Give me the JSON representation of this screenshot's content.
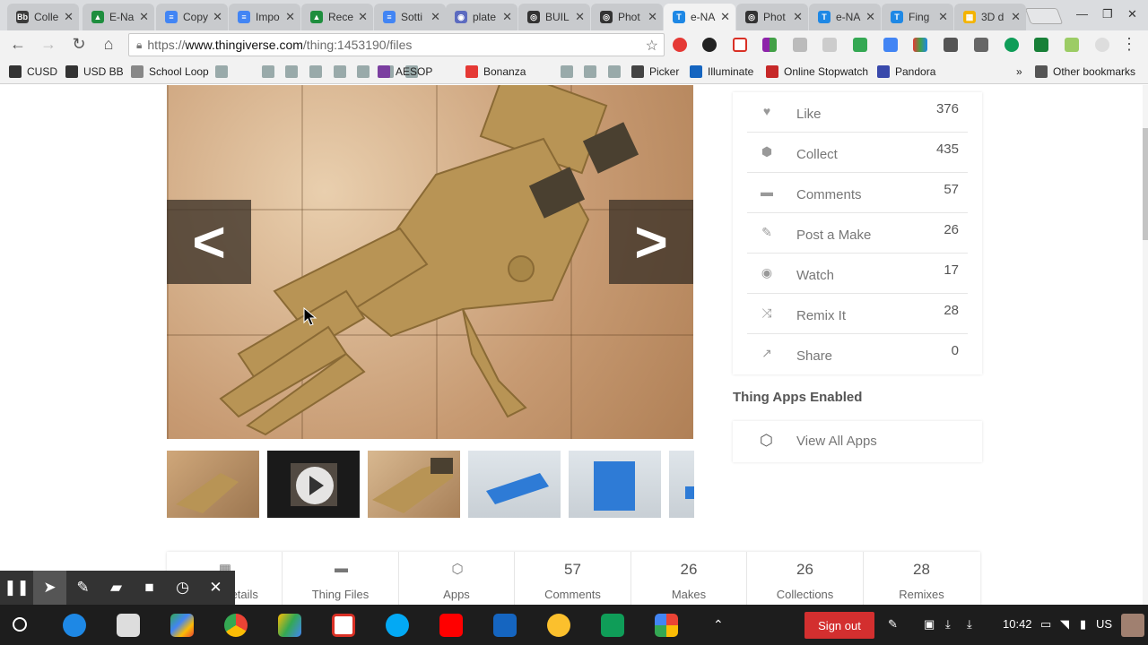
{
  "tabs": [
    {
      "label": "Colle",
      "color": "#3b3b3b",
      "glyph": "Bb"
    },
    {
      "label": "E-Na",
      "color": "#1e8e3e",
      "glyph": "▲"
    },
    {
      "label": "Copy",
      "color": "#4285f4",
      "glyph": "≡"
    },
    {
      "label": "Impo",
      "color": "#4285f4",
      "glyph": "≡"
    },
    {
      "label": "Rece",
      "color": "#1e8e3e",
      "glyph": "▲"
    },
    {
      "label": "Sotti",
      "color": "#4285f4",
      "glyph": "≡"
    },
    {
      "label": "plate",
      "color": "#5c6bc0",
      "glyph": "◉"
    },
    {
      "label": "BUIL",
      "color": "#333333",
      "glyph": "◎"
    },
    {
      "label": "Phot",
      "color": "#333333",
      "glyph": "◎"
    },
    {
      "label": "e-NA",
      "color": "#1e88e5",
      "glyph": "T"
    },
    {
      "label": "Phot",
      "color": "#333333",
      "glyph": "◎"
    },
    {
      "label": "e-NA",
      "color": "#1e88e5",
      "glyph": "T"
    },
    {
      "label": "Fing",
      "color": "#1e88e5",
      "glyph": "T"
    },
    {
      "label": "3D d",
      "color": "#f4b400",
      "glyph": "▦"
    }
  ],
  "address": {
    "prefix": "https://",
    "host": "www.thingiverse.com",
    "path": "/thing:1453190/files"
  },
  "bookmarks": [
    {
      "label": "CUSD",
      "color": "#333"
    },
    {
      "label": "USD BB",
      "color": "#333"
    },
    {
      "label": "School Loop",
      "color": "#888"
    },
    {
      "label": "AESOP",
      "color": "#7b3fa0"
    },
    {
      "label": "Bonanza",
      "color": "#e53935"
    },
    {
      "label": "Picker",
      "color": "#444"
    },
    {
      "label": "Illuminate",
      "color": "#1565c0"
    },
    {
      "label": "Online Stopwatch",
      "color": "#c62828"
    },
    {
      "label": "Pandora",
      "color": "#3949ab"
    },
    {
      "label": "»",
      "color": "transparent"
    },
    {
      "label": "Other bookmarks",
      "color": "#555"
    }
  ],
  "actions": [
    {
      "label": "Like",
      "count": "376",
      "icon": "heart-icon",
      "glyph": "♥"
    },
    {
      "label": "Collect",
      "count": "435",
      "icon": "collect-icon",
      "glyph": "⬢"
    },
    {
      "label": "Comments",
      "count": "57",
      "icon": "comment-icon",
      "glyph": "▬"
    },
    {
      "label": "Post a Make",
      "count": "26",
      "icon": "edit-icon",
      "glyph": "✎"
    },
    {
      "label": "Watch",
      "count": "17",
      "icon": "eye-icon",
      "glyph": "◉"
    },
    {
      "label": "Remix It",
      "count": "28",
      "icon": "shuffle-icon",
      "glyph": "⤨"
    },
    {
      "label": "Share",
      "count": "0",
      "icon": "share-icon",
      "glyph": "↗"
    }
  ],
  "apps": {
    "title": "Thing Apps Enabled",
    "view_all": "View All Apps"
  },
  "bottom_tabs": [
    {
      "label": "Thing Details",
      "num": "",
      "icon": "details-icon",
      "glyph": "▦"
    },
    {
      "label": "Thing Files",
      "num": "",
      "icon": "folder-icon",
      "glyph": "▬"
    },
    {
      "label": "Apps",
      "num": "",
      "icon": "cube-icon",
      "glyph": "⬡"
    },
    {
      "label": "Comments",
      "num": "57"
    },
    {
      "label": "Makes",
      "num": "26"
    },
    {
      "label": "Collections",
      "num": "26"
    },
    {
      "label": "Remixes",
      "num": "28"
    }
  ],
  "carousel": {
    "prev": "<",
    "next": ">"
  },
  "shelf": {
    "sign_out": "Sign out",
    "time": "10:42",
    "locale": "US"
  }
}
